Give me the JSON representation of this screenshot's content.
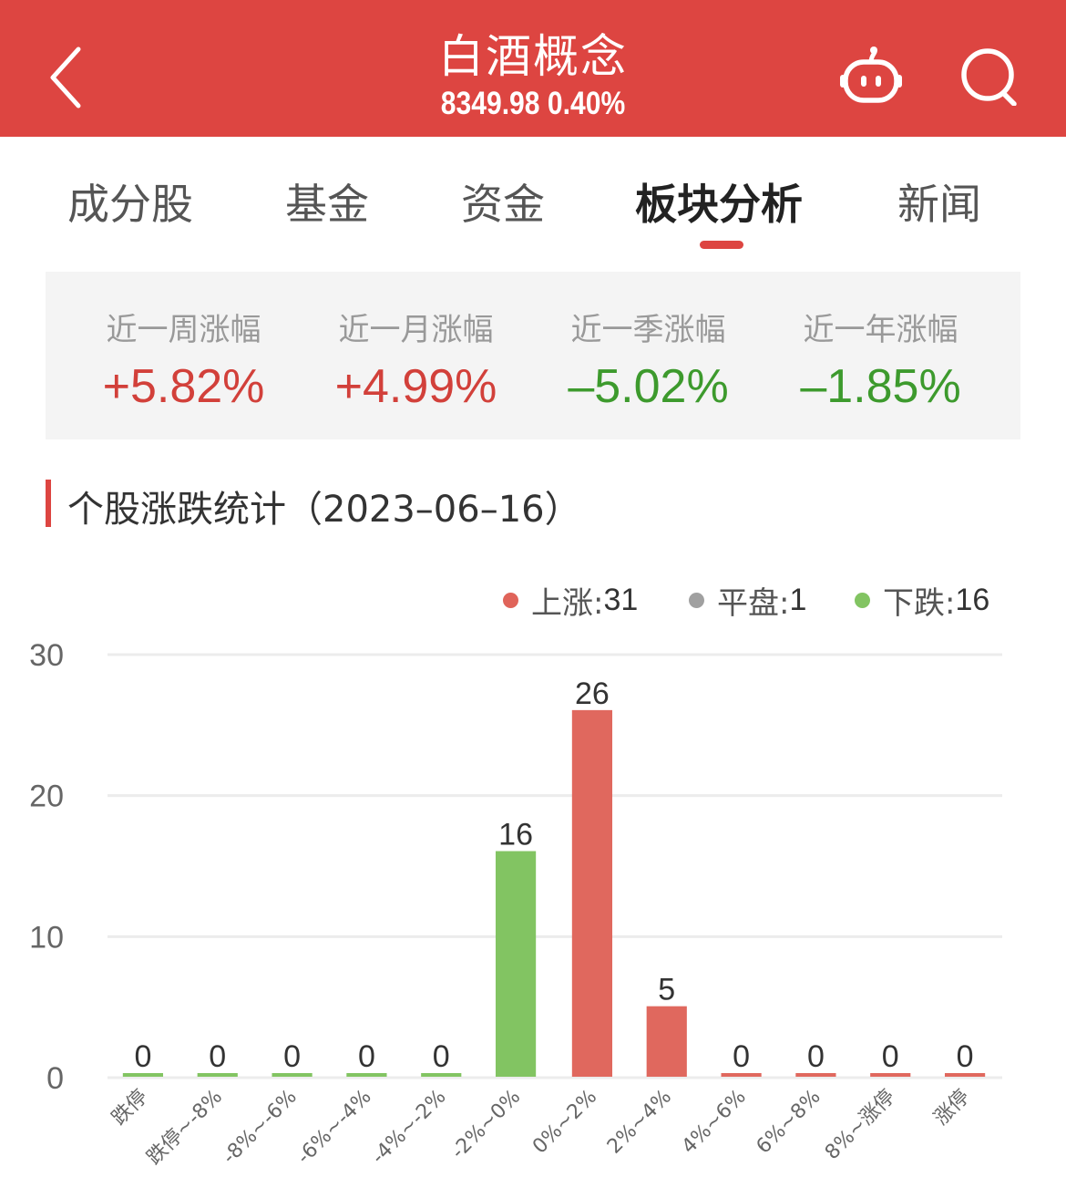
{
  "header": {
    "title": "白酒概念",
    "index_value": "8349.98",
    "index_change": "0.40%",
    "subtitle": "8349.98 0.40%",
    "icons": {
      "back": "chevron-left-icon",
      "robot": "robot-assistant-icon",
      "search": "search-icon"
    },
    "background_color": "#dd4541"
  },
  "tabs": [
    {
      "label": "成分股",
      "active": false
    },
    {
      "label": "基金",
      "active": false
    },
    {
      "label": "资金",
      "active": false
    },
    {
      "label": "板块分析",
      "active": true
    },
    {
      "label": "新闻",
      "active": false
    }
  ],
  "performance": [
    {
      "label": "近一周涨幅",
      "value": "+5.82%",
      "direction": "up"
    },
    {
      "label": "近一月涨幅",
      "value": "+4.99%",
      "direction": "up"
    },
    {
      "label": "近一季涨幅",
      "value": "–5.02%",
      "direction": "down"
    },
    {
      "label": "近一年涨幅",
      "value": "–1.85%",
      "direction": "down"
    }
  ],
  "section": {
    "title": "个股涨跌统计（2023–06–16）"
  },
  "legend": [
    {
      "label": "上涨: ",
      "count": "31",
      "color": "#e0645a"
    },
    {
      "label": "平盘: ",
      "count": "1",
      "color": "#a0a0a0"
    },
    {
      "label": "下跌: ",
      "count": "16",
      "color": "#82c462"
    }
  ],
  "colors": {
    "up": "#e0685e",
    "down": "#82c462",
    "up_text": "#d2403a",
    "down_text": "#3d9a2d"
  },
  "chart_data": {
    "type": "bar",
    "title": "个股涨跌统计（2023–06–16）",
    "xlabel": "",
    "ylabel": "",
    "ylim": [
      0,
      30
    ],
    "yticks": [
      0,
      10,
      20,
      30
    ],
    "grid": true,
    "legend_position": "top-right",
    "categories": [
      "跌停",
      "跌停~-8%",
      "-8%~-6%",
      "-6%~-4%",
      "-4%~-2%",
      "-2%~0%",
      "0%~2%",
      "2%~4%",
      "4%~6%",
      "6%~8%",
      "8%~涨停",
      "涨停"
    ],
    "values": [
      0,
      0,
      0,
      0,
      0,
      16,
      26,
      5,
      0,
      0,
      0,
      0
    ],
    "bar_colors": [
      "down",
      "down",
      "down",
      "down",
      "down",
      "down",
      "up",
      "up",
      "up",
      "up",
      "up",
      "up"
    ],
    "legend": [
      {
        "name": "上涨",
        "count": 31
      },
      {
        "name": "平盘",
        "count": 1
      },
      {
        "name": "下跌",
        "count": 16
      }
    ]
  }
}
